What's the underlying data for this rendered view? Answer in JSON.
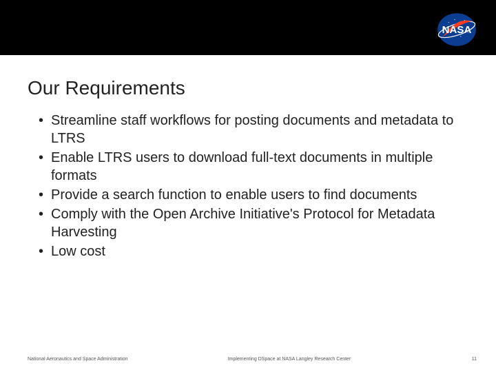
{
  "title": "Our Requirements",
  "bullets": [
    "Streamline staff workflows for posting documents and metadata to LTRS",
    "Enable LTRS users to download full-text documents in multiple formats",
    "Provide a search function to enable users to find documents",
    "Comply with the Open Archive Initiative's Protocol for Metadata Harvesting",
    "Low cost"
  ],
  "footer": {
    "left": "National Aeronautics and Space Administration",
    "center": "Implementing DSpace at NASA Langley Research Center",
    "page": "11"
  }
}
